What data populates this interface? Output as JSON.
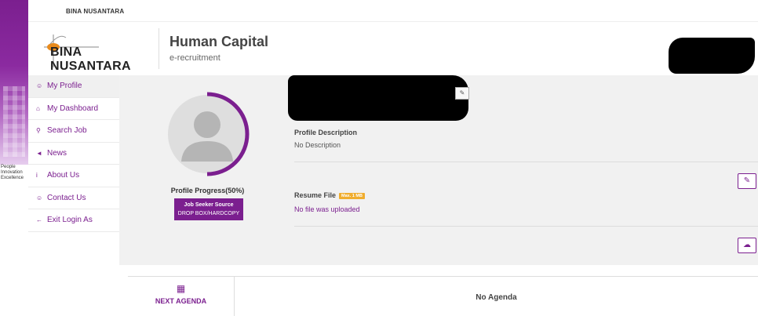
{
  "brand": {
    "top_label": "BINA NUSANTARA",
    "logo_text": "BINA NUSANTARA",
    "tagline": [
      "People",
      "Innovation",
      "Excellence"
    ]
  },
  "header": {
    "title": "Human Capital",
    "subtitle": "e-recruitment"
  },
  "sidebar": {
    "items": [
      {
        "label": "My Profile",
        "icon": "user-icon",
        "glyph": "☺",
        "active": true
      },
      {
        "label": "My Dashboard",
        "icon": "home-icon",
        "glyph": "⌂",
        "active": false
      },
      {
        "label": "Search Job",
        "icon": "search-icon",
        "glyph": "⚲",
        "active": false
      },
      {
        "label": "News",
        "icon": "bullhorn-icon",
        "glyph": "◄",
        "active": false
      },
      {
        "label": "About Us",
        "icon": "info-icon",
        "glyph": "i",
        "active": false
      },
      {
        "label": "Contact Us",
        "icon": "contact-icon",
        "glyph": "☺",
        "active": false
      },
      {
        "label": "Exit Login As",
        "icon": "arrow-left-icon",
        "glyph": "←",
        "active": false
      }
    ]
  },
  "profile": {
    "progress_label": "Profile Progress(50%)",
    "progress_value": 0.5,
    "source_title": "Job Seeker Source",
    "source_value": "DROP BOX/HARDCOPY",
    "description_title": "Profile Description",
    "description_text": "No Description",
    "resume_title": "Resume File",
    "resume_badge": "Max. 1 MB",
    "resume_status": "No file was uploaded"
  },
  "agenda": {
    "label": "NEXT AGENDA",
    "status": "No Agenda"
  },
  "colors": {
    "accent": "#7b1f8f",
    "badge": "#f0ad2e",
    "content_bg": "#f1f1f1"
  }
}
